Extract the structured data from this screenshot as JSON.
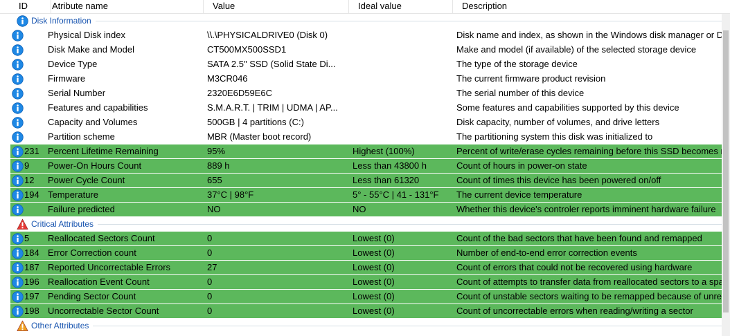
{
  "columns": [
    {
      "key": "id",
      "label": "ID"
    },
    {
      "key": "name",
      "label": "Atribute name"
    },
    {
      "key": "value",
      "label": "Value"
    },
    {
      "key": "ideal",
      "label": "Ideal value"
    },
    {
      "key": "desc",
      "label": "Description"
    }
  ],
  "colors": {
    "good_row": "#5cb85c",
    "group_title": "#1a56b0",
    "info_icon": "#1e88e5",
    "warning_icon": "#e53935",
    "warning_icon_orange": "#f0a020"
  },
  "groups": [
    {
      "title": "Disk Information",
      "icon": "info-icon",
      "rows": [
        {
          "id": "",
          "name": "Physical Disk index",
          "value": "\\\\.\\PHYSICALDRIVE0 (Disk 0)",
          "ideal": "",
          "desc": "Disk name and index, as shown in the Windows disk manager or D",
          "status": "none"
        },
        {
          "id": "",
          "name": "Disk Make and Model",
          "value": "CT500MX500SSD1",
          "ideal": "",
          "desc": "Make and model (if available) of the selected storage device",
          "status": "none"
        },
        {
          "id": "",
          "name": "Device Type",
          "value": "SATA  2.5\" SSD (Solid State Di...",
          "ideal": "",
          "desc": "The type of the storage device",
          "status": "none"
        },
        {
          "id": "",
          "name": "Firmware",
          "value": "M3CR046",
          "ideal": "",
          "desc": "The current firmware product revision",
          "status": "none"
        },
        {
          "id": "",
          "name": "Serial Number",
          "value": "2320E6D59E6C",
          "ideal": "",
          "desc": "The serial number of this device",
          "status": "none"
        },
        {
          "id": "",
          "name": "Features and capabilities",
          "value": "S.M.A.R.T. | TRIM | UDMA | AP...",
          "ideal": "",
          "desc": "Some features and capabilities supported by this device",
          "status": "none"
        },
        {
          "id": "",
          "name": "Capacity and Volumes",
          "value": "500GB | 4 partitions (C:)",
          "ideal": "",
          "desc": "Disk capacity, number of volumes, and drive letters",
          "status": "none"
        },
        {
          "id": "",
          "name": "Partition scheme",
          "value": "MBR (Master boot record)",
          "ideal": "",
          "desc": "The partitioning system this disk was initialized to",
          "status": "none"
        },
        {
          "id": "231",
          "name": "Percent Lifetime Remaining",
          "value": "95%",
          "ideal": "Highest (100%)",
          "desc": "Percent of write/erase cycles remaining before this SSD becomes r",
          "status": "good"
        },
        {
          "id": "9",
          "name": "Power-On Hours Count",
          "value": "889 h",
          "ideal": "Less than 43800 h",
          "desc": "Count of hours in power-on state",
          "status": "good"
        },
        {
          "id": "12",
          "name": "Power Cycle Count",
          "value": "655",
          "ideal": "Less than 61320",
          "desc": "Count of times this device has been powered on/off",
          "status": "good"
        },
        {
          "id": "194",
          "name": "Temperature",
          "value": "37°C | 98°F",
          "ideal": "5° - 55°C | 41 - 131°F",
          "desc": "The current device temperature",
          "status": "good"
        },
        {
          "id": "",
          "name": "Failure predicted",
          "value": "NO",
          "ideal": "NO",
          "desc": "Whether this device's controler reports imminent hardware failure",
          "status": "good"
        }
      ]
    },
    {
      "title": "Critical Attributes",
      "icon": "warning-icon",
      "rows": [
        {
          "id": "5",
          "name": "Reallocated Sectors Count",
          "value": "0",
          "ideal": "Lowest (0)",
          "desc": "Count of the bad sectors that have been found and remapped",
          "status": "good"
        },
        {
          "id": "184",
          "name": "Error Correction count",
          "value": "0",
          "ideal": "Lowest (0)",
          "desc": "Number of end-to-end error correction events",
          "status": "good"
        },
        {
          "id": "187",
          "name": "Reported Uncorrectable Errors",
          "value": "27",
          "ideal": "Lowest (0)",
          "desc": "Count of errors that could not be recovered using hardware",
          "status": "good"
        },
        {
          "id": "196",
          "name": "Reallocation Event Count",
          "value": "0",
          "ideal": "Lowest (0)",
          "desc": "Count of attempts to transfer data from reallocated sectors to a spa",
          "status": "good"
        },
        {
          "id": "197",
          "name": "Pending Sector Count",
          "value": "0",
          "ideal": "Lowest (0)",
          "desc": "Count of unstable sectors waiting to be remapped because of unrec",
          "status": "good"
        },
        {
          "id": "198",
          "name": "Uncorrectable Sector Count",
          "value": "0",
          "ideal": "Lowest (0)",
          "desc": "Count of uncorrectable errors when reading/writing a sector",
          "status": "good"
        }
      ]
    },
    {
      "title": "Other Attributes",
      "icon": "warning-icon-orange",
      "rows": []
    }
  ]
}
